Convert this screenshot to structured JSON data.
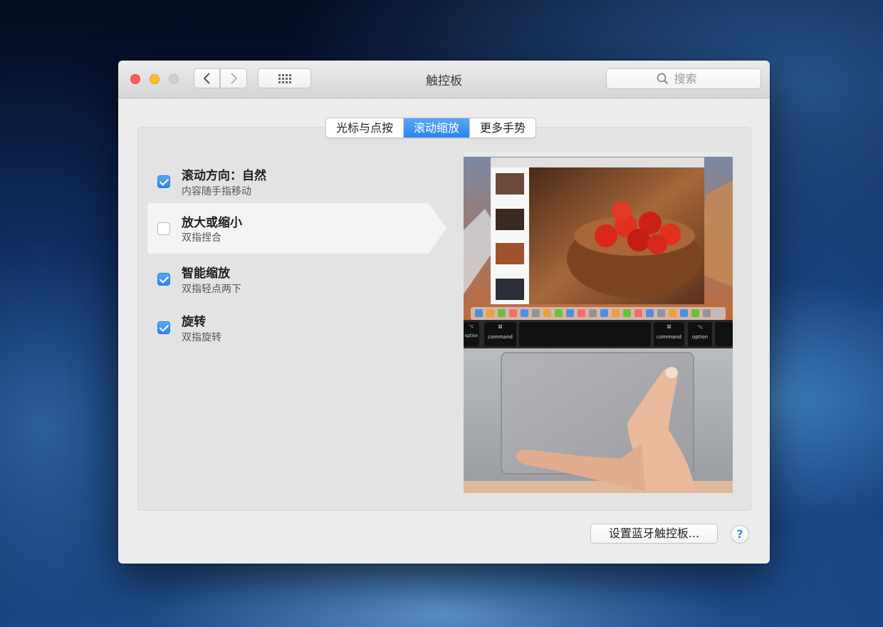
{
  "window": {
    "title": "触控板"
  },
  "toolbar": {
    "back_icon": "chevron-left-icon",
    "forward_icon": "chevron-right-icon",
    "grid_icon": "grid-icon"
  },
  "search": {
    "placeholder": "搜索",
    "icon": "search-icon"
  },
  "tabs": [
    {
      "label": "光标与点按",
      "active": false
    },
    {
      "label": "滚动缩放",
      "active": true
    },
    {
      "label": "更多手势",
      "active": false
    }
  ],
  "options": [
    {
      "label": "滚动方向：自然",
      "sublabel": "内容随手指移动",
      "checked": true
    },
    {
      "label": "放大或缩小",
      "sublabel": "双指捏合",
      "checked": false
    },
    {
      "label": "智能缩放",
      "sublabel": "双指轻点两下",
      "checked": true
    },
    {
      "label": "旋转",
      "sublabel": "双指旋转",
      "checked": true
    }
  ],
  "preview": {
    "keys": [
      {
        "symbol": "⌥",
        "label": "option"
      },
      {
        "symbol": "⌘",
        "label": "command"
      },
      {
        "symbol": "⌘",
        "label": "command"
      },
      {
        "symbol": "⌥",
        "label": "option"
      }
    ]
  },
  "footer": {
    "bluetooth_button": "设置蓝牙触控板...",
    "help_label": "?"
  },
  "colors": {
    "accent": "#2c84ef",
    "close": "#fc5f57",
    "minimize": "#fdbc2e"
  }
}
